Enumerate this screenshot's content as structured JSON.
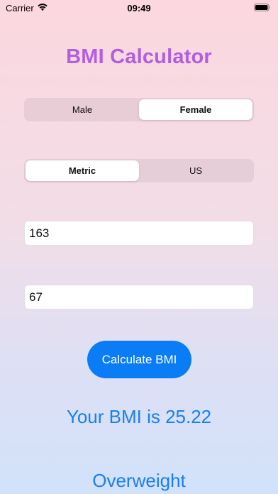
{
  "status_bar": {
    "carrier": "Carrier",
    "time": "09:49",
    "wifi_icon": "wifi-icon",
    "battery_icon": "battery-icon"
  },
  "title": "BMI Calculator",
  "gender_selector": {
    "options": [
      "Male",
      "Female"
    ],
    "selected": "Female"
  },
  "unit_selector": {
    "options": [
      "Metric",
      "US"
    ],
    "selected": "Metric"
  },
  "height_field": {
    "value": "163"
  },
  "weight_field": {
    "value": "67"
  },
  "calculate_button": {
    "label": "Calculate BMI"
  },
  "result": {
    "bmi_text": "Your BMI is 25.22",
    "category": "Overweight"
  },
  "colors": {
    "title": "#b05fe0",
    "accent": "#0a7cf5",
    "result_text": "#1a7ff0"
  }
}
